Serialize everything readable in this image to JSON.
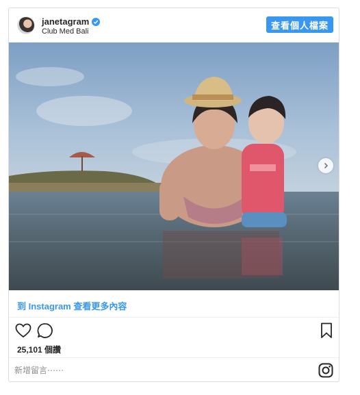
{
  "header": {
    "username": "janetagram",
    "location": "Club Med Bali",
    "view_profile_label": "查看個人檔案"
  },
  "photo": {
    "alt": "janetagram photo"
  },
  "post": {
    "more_link": "到 Instagram 查看更多內容",
    "likes": "25,101 個讚"
  },
  "comment": {
    "placeholder": "新增留言⋯⋯"
  },
  "icons": {
    "verified": "verified-badge-icon",
    "next": "chevron-right-icon",
    "like": "heart-icon",
    "comment": "comment-bubble-icon",
    "bookmark": "bookmark-icon",
    "logo": "instagram-logo-icon"
  },
  "colors": {
    "accent": "#3897f0",
    "border": "#dbdbdb"
  }
}
